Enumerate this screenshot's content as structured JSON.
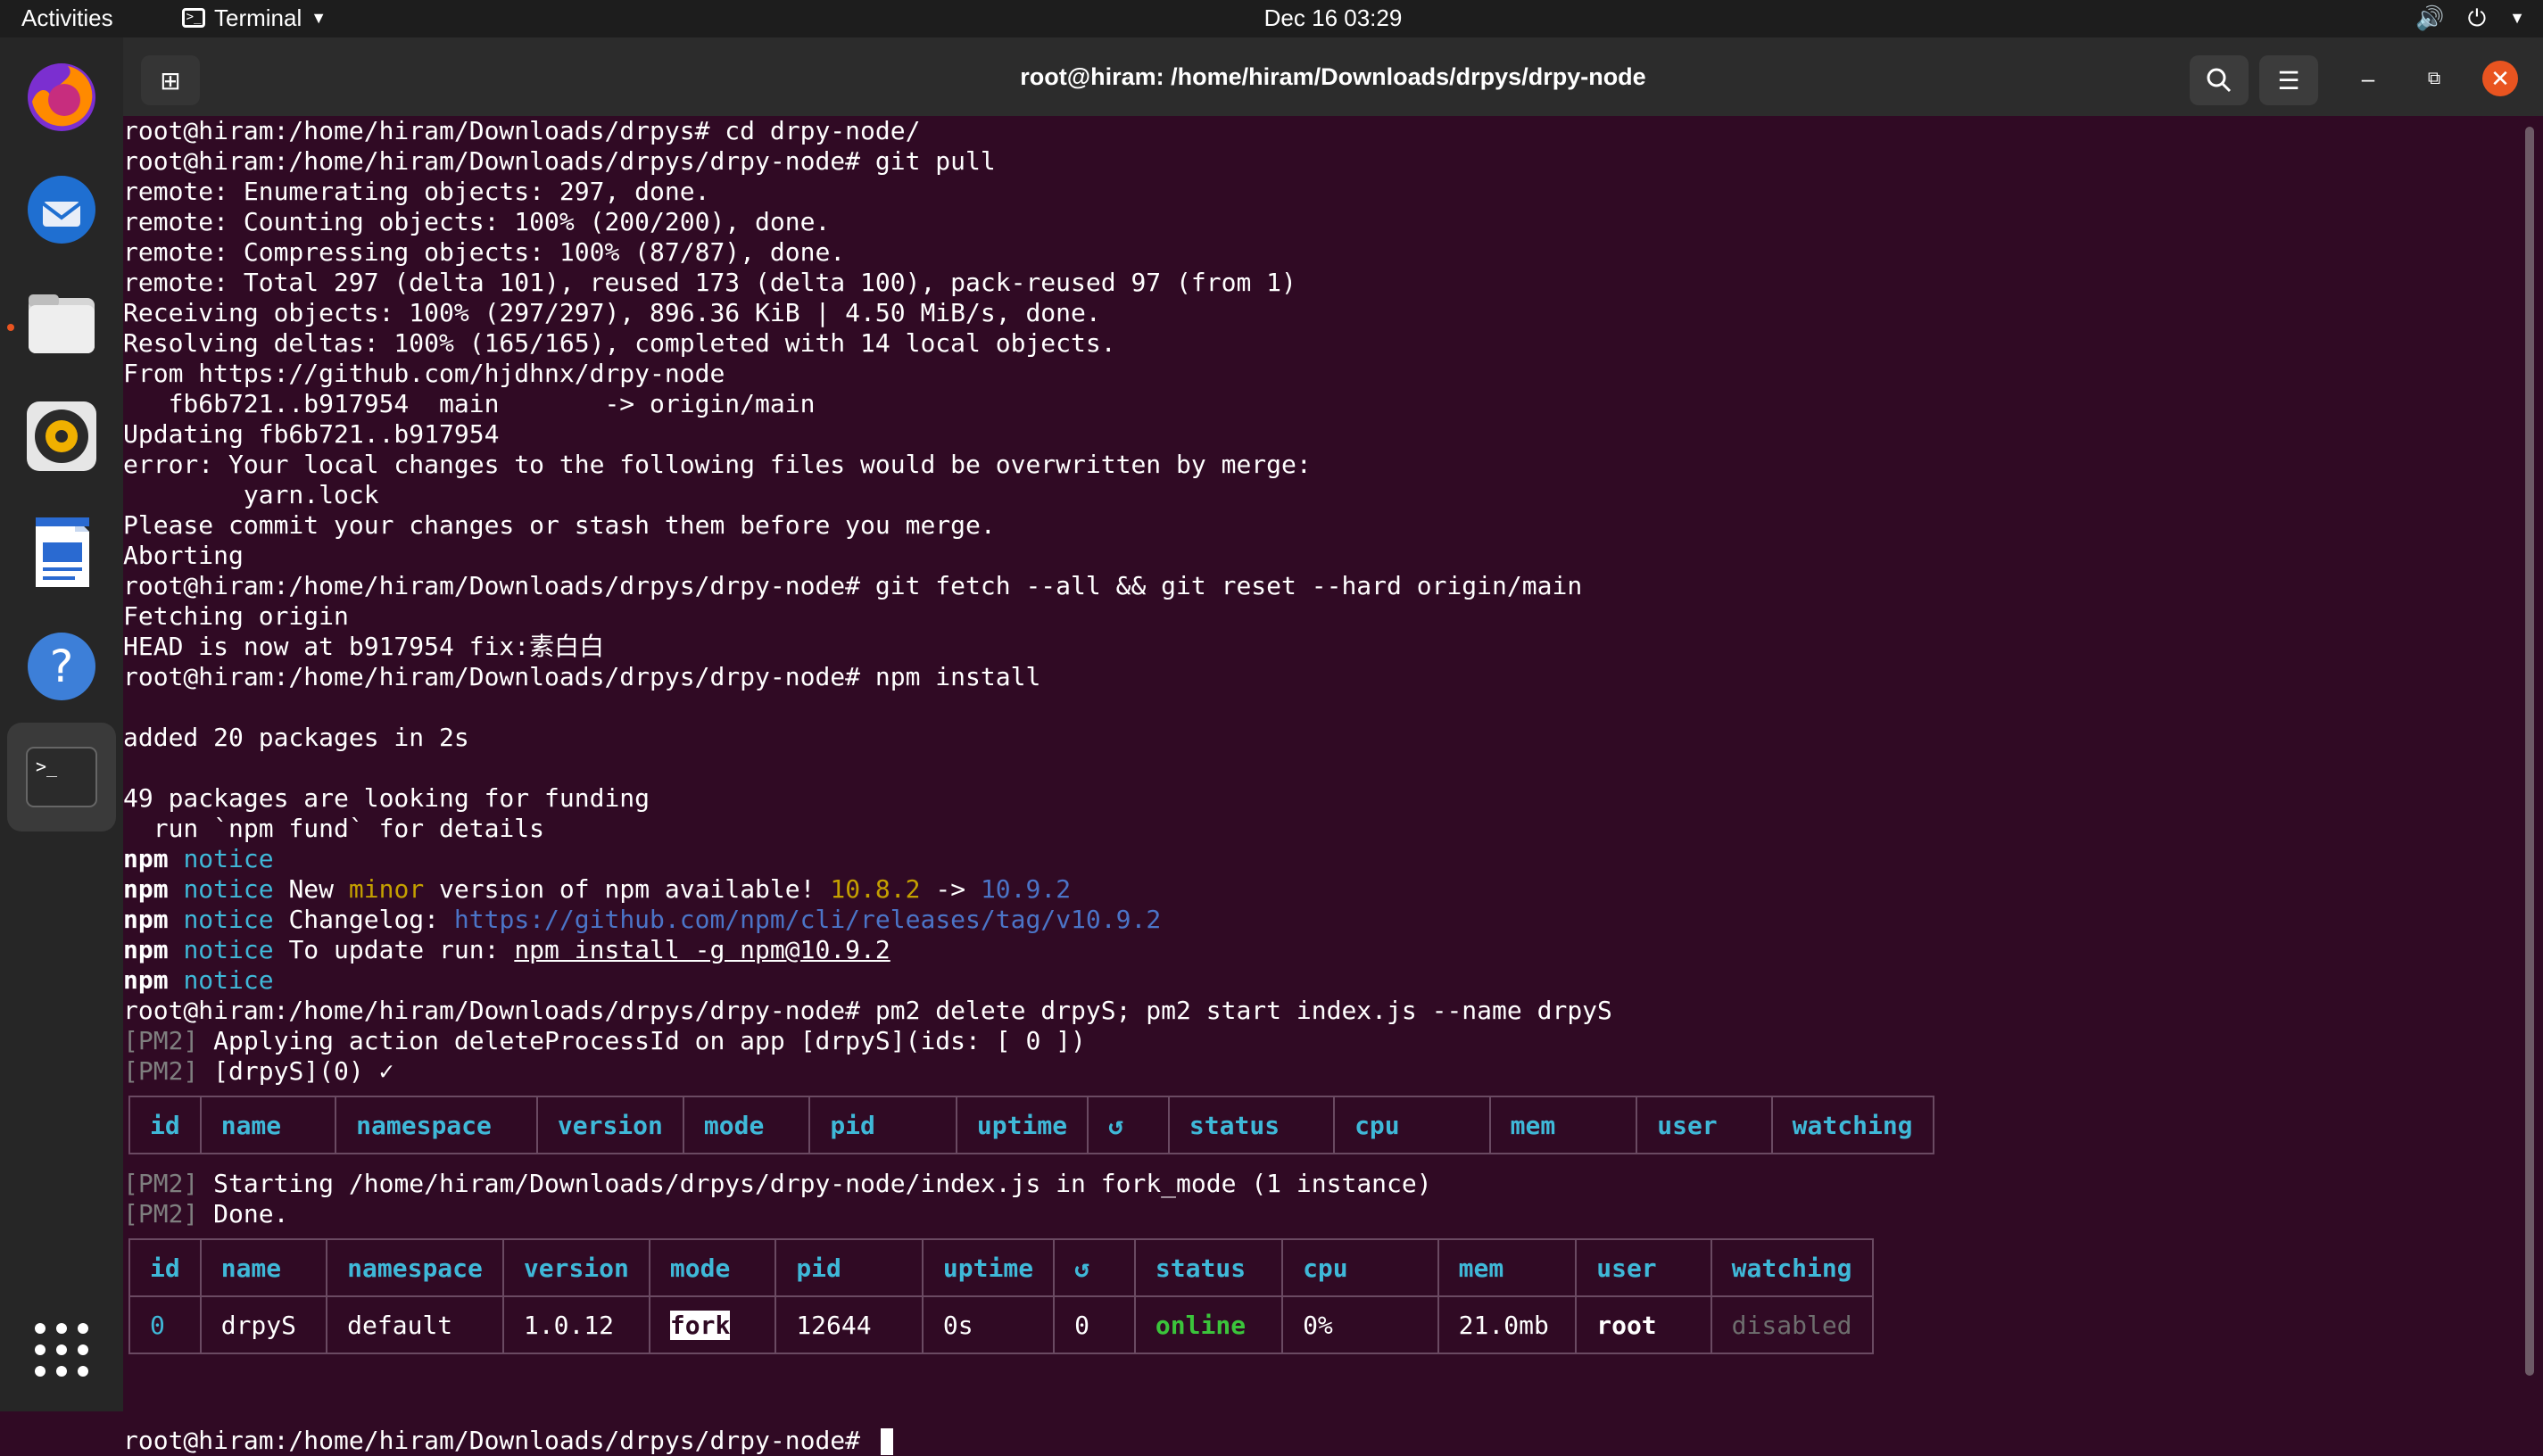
{
  "topbar": {
    "activities": "Activities",
    "app_name": "Terminal",
    "clock": "Dec 16  03:29"
  },
  "dock": {
    "items": [
      {
        "name": "Firefox",
        "icon": "firefox-icon"
      },
      {
        "name": "Thunderbird",
        "icon": "thunderbird-icon"
      },
      {
        "name": "Files",
        "icon": "files-icon"
      },
      {
        "name": "Rhythmbox",
        "icon": "rhythmbox-icon"
      },
      {
        "name": "LibreOffice Writer",
        "icon": "writer-icon"
      },
      {
        "name": "Help",
        "icon": "help-icon"
      },
      {
        "name": "Terminal",
        "icon": "terminal-icon"
      }
    ],
    "show_apps": "show-apps-icon"
  },
  "window": {
    "title": "root@hiram: /home/hiram/Downloads/drpys/drpy-node"
  },
  "terminal": {
    "l01": "root@hiram:/home/hiram/Downloads/drpys# cd drpy-node/",
    "l02": "root@hiram:/home/hiram/Downloads/drpys/drpy-node# git pull",
    "l03": "remote: Enumerating objects: 297, done.",
    "l04": "remote: Counting objects: 100% (200/200), done.",
    "l05": "remote: Compressing objects: 100% (87/87), done.",
    "l06": "remote: Total 297 (delta 101), reused 173 (delta 100), pack-reused 97 (from 1)",
    "l07": "Receiving objects: 100% (297/297), 896.36 KiB | 4.50 MiB/s, done.",
    "l08": "Resolving deltas: 100% (165/165), completed with 14 local objects.",
    "l09": "From https://github.com/hjdhnx/drpy-node",
    "l10": "   fb6b721..b917954  main       -> origin/main",
    "l11": "Updating fb6b721..b917954",
    "l12": "error: Your local changes to the following files would be overwritten by merge:",
    "l13": "        yarn.lock",
    "l14": "Please commit your changes or stash them before you merge.",
    "l15": "Aborting",
    "l16": "root@hiram:/home/hiram/Downloads/drpys/drpy-node# git fetch --all && git reset --hard origin/main",
    "l17": "Fetching origin",
    "l18": "HEAD is now at b917954 fix:素白白",
    "l19": "root@hiram:/home/hiram/Downloads/drpys/drpy-node# npm install",
    "l21": "added 20 packages in 2s",
    "l23": "49 packages are looking for funding",
    "l24": "  run `npm fund` for details",
    "npm": "npm",
    "notice": "notice",
    "n2_a": " New ",
    "n2_minor": "minor",
    "n2_b": " version of npm available! ",
    "n2_old": "10.8.2",
    "n2_arrow": " -> ",
    "n2_new": "10.9.2",
    "n3_a": " Changelog: ",
    "n3_url": "https://github.com/npm/cli/releases/tag/v10.9.2",
    "n4_a": " To update run: ",
    "n4_cmd": "npm install -g npm@10.9.2",
    "l30": "root@hiram:/home/hiram/Downloads/drpys/drpy-node# pm2 delete drpyS; pm2 start index.js --name drpyS",
    "pm2_tag": "[PM2]",
    "l31": " Applying action deleteProcessId on app [drpyS](ids: [ 0 ])",
    "l32": " [drpyS](0) ✓",
    "l33": " Starting /home/hiram/Downloads/drpys/drpy-node/index.js in fork_mode (1 instance)",
    "l34": " Done.",
    "prompt": "root@hiram:/home/hiram/Downloads/drpys/drpy-node# "
  },
  "table": {
    "headers": [
      "id",
      "name",
      "namespace",
      "version",
      "mode",
      "pid",
      "uptime",
      "↺",
      "status",
      "cpu",
      "mem",
      "user",
      "watching"
    ],
    "row": [
      "0",
      "drpyS",
      "default",
      "1.0.12",
      "fork",
      "12644",
      "0s",
      "0",
      "online",
      "0%",
      "21.0mb",
      "root",
      "disabled"
    ]
  },
  "colors": {
    "terminal_bg": "#300a24",
    "accent": "#e95420",
    "cyan": "#3fb8d8",
    "online": "#3bc43b"
  }
}
